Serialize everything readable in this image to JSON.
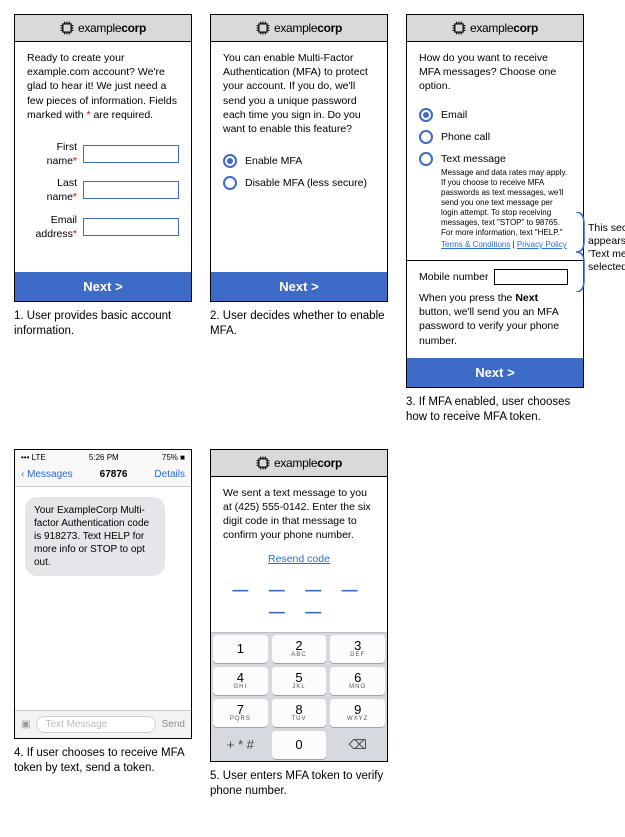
{
  "brand": {
    "part1": "example",
    "part2": "corp"
  },
  "next_label": "Next  >",
  "card1": {
    "intro_pre": "Ready to create your example.com account? We're glad to hear it! We just need a few pieces of information. Fields marked with ",
    "intro_post": " are required.",
    "asterisk": "*",
    "fields": {
      "first_name_label": "First name",
      "last_name_label": "Last name",
      "email_label": "Email address"
    },
    "caption": "1. User provides basic account information."
  },
  "card2": {
    "intro": "You can enable Multi-Factor Authentication (MFA) to protect your account. If you do, we'll send you a unique password each time you sign in. Do you want to enable this feature?",
    "opt_enable": "Enable MFA",
    "opt_disable": "Disable MFA (less secure)",
    "caption": "2. User decides whether to enable MFA."
  },
  "card3": {
    "intro": "How do you want to receive MFA messages? Choose one option.",
    "opt_email": "Email",
    "opt_phone": "Phone call",
    "opt_text": "Text message",
    "fine": "Message and data rates may apply. If you choose to receive MFA passwords as text messages, we'll send you one text message per login attempt. To stop receiving messages, text \"STOP\" to 98765. For more information, text \"HELP.\"",
    "terms": "Terms & Conditions",
    "sep": " | ",
    "privacy": "Privacy Policy",
    "mobile_label": "Mobile number",
    "mobile_note_1": "When you press the ",
    "mobile_note_bold": "Next",
    "mobile_note_2": " button, we'll send you an MFA password to verify your phone number.",
    "annotation": "This section only appears when 'Text message' is selected",
    "caption": "3. If MFA enabled, user chooses how to receive MFA token."
  },
  "phone": {
    "status_left": "•••   LTE",
    "status_time": "5:26 PM",
    "status_batt": "75% ■",
    "back": "Messages",
    "title": "67876",
    "details": "Details",
    "bubble": "Your ExampleCorp Multi-factor Authentication code is 918273. Text HELP for more info or STOP to opt out.",
    "placeholder": "Text Message",
    "send": "Send",
    "caption": "4. If user chooses to receive MFA token by text, send a token."
  },
  "card5": {
    "intro": "We sent a text message to you at (425) 555-0142. Enter the six digit code in that message to confirm your phone number.",
    "resend": "Resend code",
    "dashes": "— — — — — —",
    "keys": [
      [
        "1",
        ""
      ],
      [
        "2",
        "ABC"
      ],
      [
        "3",
        "DEF"
      ],
      [
        "4",
        "GHI"
      ],
      [
        "5",
        "JKL"
      ],
      [
        "6",
        "MNO"
      ],
      [
        "7",
        "PQRS"
      ],
      [
        "8",
        "TUV"
      ],
      [
        "9",
        "WXYZ"
      ],
      [
        "+ * #",
        ""
      ],
      [
        "0",
        ""
      ],
      [
        "⌫",
        ""
      ]
    ],
    "caption": "5. User enters MFA token to verify phone number."
  }
}
